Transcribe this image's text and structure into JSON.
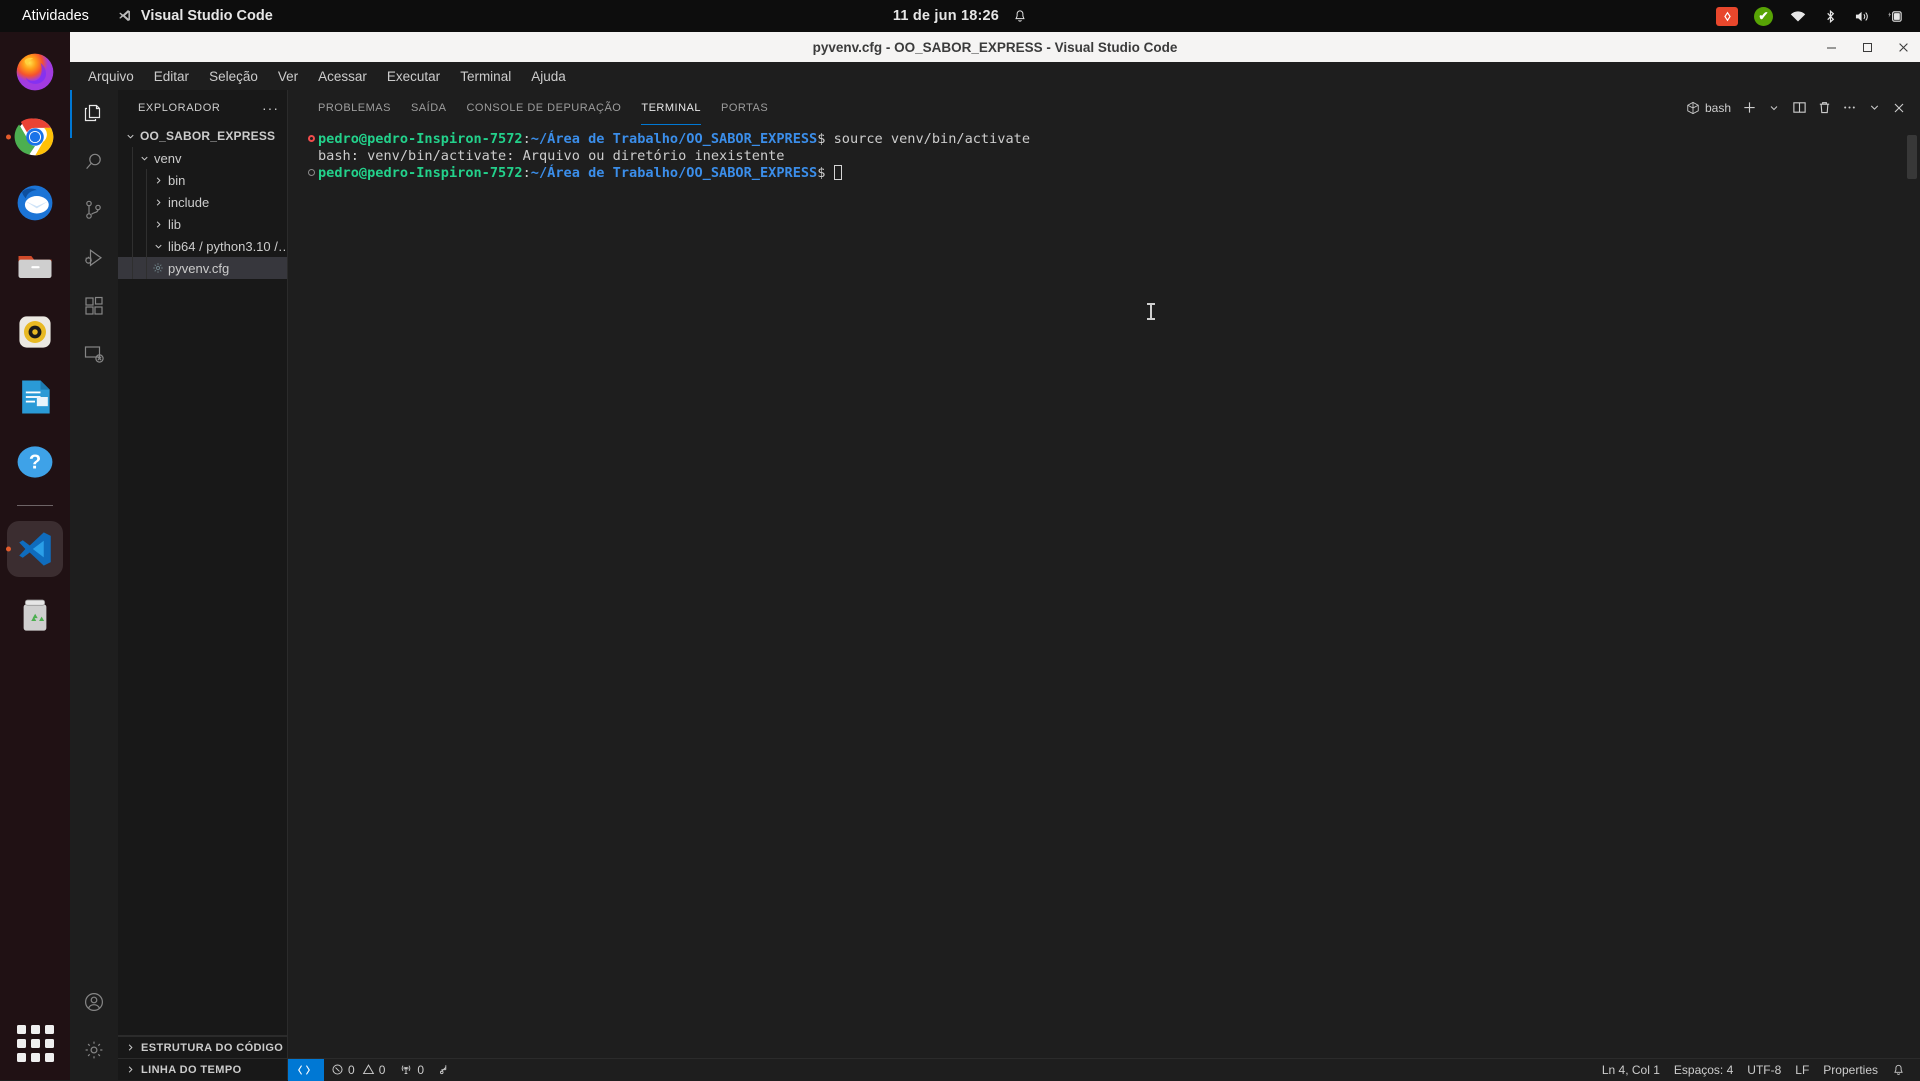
{
  "desktop": {
    "activities_label": "Atividades",
    "app_name": "Visual Studio Code",
    "clock": "11 de jun  18:26",
    "tray": [
      {
        "name": "red-badge-icon",
        "label": ""
      },
      {
        "name": "green-check-icon",
        "label": "✔"
      },
      {
        "name": "wifi-icon",
        "label": ""
      },
      {
        "name": "bluetooth-icon",
        "label": ""
      },
      {
        "name": "volume-icon",
        "label": ""
      },
      {
        "name": "battery-icon",
        "label": ""
      }
    ],
    "dock": [
      {
        "name": "firefox",
        "label": "Firefox"
      },
      {
        "name": "chrome",
        "label": "Google Chrome"
      },
      {
        "name": "thunderbird",
        "label": "Thunderbird Mail"
      },
      {
        "name": "files",
        "label": "Arquivos"
      },
      {
        "name": "rhythmbox",
        "label": "Rhythmbox"
      },
      {
        "name": "libreoffice-writer",
        "label": "LibreOffice Writer"
      },
      {
        "name": "help",
        "label": "Ajuda"
      },
      {
        "name": "vscode",
        "label": "Visual Studio Code"
      },
      {
        "name": "trash",
        "label": "Lixeira"
      }
    ],
    "show_apps_label": "Mostrar aplicativos"
  },
  "window": {
    "title": "pyvenv.cfg - OO_SABOR_EXPRESS - Visual Studio Code",
    "controls": {
      "minimize": "—",
      "maximize": "▫",
      "close": "✕"
    }
  },
  "menubar": [
    "Arquivo",
    "Editar",
    "Seleção",
    "Ver",
    "Acessar",
    "Executar",
    "Terminal",
    "Ajuda"
  ],
  "activitybar": {
    "top": [
      {
        "name": "explorer-icon",
        "active": true
      },
      {
        "name": "search-icon",
        "active": false
      },
      {
        "name": "source-control-icon",
        "active": false
      },
      {
        "name": "run-and-debug-icon",
        "active": false
      },
      {
        "name": "extensions-icon",
        "active": false
      },
      {
        "name": "remote-explorer-icon",
        "active": false
      }
    ],
    "bottom": [
      {
        "name": "accounts-icon"
      },
      {
        "name": "manage-settings-icon"
      }
    ]
  },
  "sidebar": {
    "header": "EXPLORADOR",
    "more_actions": "···",
    "tree": [
      {
        "label": "OO_SABOR_EXPRESS",
        "depth": 0,
        "state": "expanded",
        "type": "folder",
        "selected": false
      },
      {
        "label": "venv",
        "depth": 1,
        "state": "expanded",
        "type": "folder",
        "selected": false
      },
      {
        "label": "bin",
        "depth": 2,
        "state": "collapsed",
        "type": "folder",
        "selected": false
      },
      {
        "label": "include",
        "depth": 2,
        "state": "collapsed",
        "type": "folder",
        "selected": false
      },
      {
        "label": "lib",
        "depth": 2,
        "state": "collapsed",
        "type": "folder",
        "selected": false
      },
      {
        "label": "lib64 / python3.10 /…",
        "depth": 2,
        "state": "expanded",
        "type": "folder",
        "selected": false
      },
      {
        "label": "pyvenv.cfg",
        "depth": 2,
        "state": "file",
        "type": "config-file",
        "selected": true
      }
    ],
    "sections": [
      {
        "label": "ESTRUTURA DO CÓDIGO",
        "state": "collapsed"
      },
      {
        "label": "LINHA DO TEMPO",
        "state": "collapsed"
      }
    ]
  },
  "panel": {
    "tabs": [
      {
        "label": "PROBLEMAS",
        "active": false
      },
      {
        "label": "SAÍDA",
        "active": false
      },
      {
        "label": "CONSOLE DE DEPURAÇÃO",
        "active": false
      },
      {
        "label": "TERMINAL",
        "active": true
      },
      {
        "label": "PORTAS",
        "active": false
      }
    ],
    "shell_label": "bash",
    "actions": [
      {
        "name": "new-terminal-icon",
        "label": "+"
      },
      {
        "name": "chevron-down-icon",
        "label": "⌄"
      },
      {
        "name": "split-terminal-icon",
        "label": ""
      },
      {
        "name": "kill-terminal-icon",
        "label": ""
      },
      {
        "name": "terminal-more-icon",
        "label": "···"
      },
      {
        "name": "maximize-panel-icon",
        "label": "⌄"
      },
      {
        "name": "close-panel-icon",
        "label": "✕"
      }
    ]
  },
  "terminal": {
    "lines": [
      {
        "marker": "error",
        "segments": [
          {
            "text": "pedro@pedro-Inspiron-7572",
            "style": "user"
          },
          {
            "text": ":",
            "style": "plain"
          },
          {
            "text": "~/Área de Trabalho/OO_SABOR_EXPRESS",
            "style": "path"
          },
          {
            "text": "$ source venv/bin/activate",
            "style": "plain"
          }
        ]
      },
      {
        "marker": "none",
        "segments": [
          {
            "text": "bash: venv/bin/activate: Arquivo ou diretório inexistente",
            "style": "plain"
          }
        ]
      },
      {
        "marker": "ok",
        "segments": [
          {
            "text": "pedro@pedro-Inspiron-7572",
            "style": "user"
          },
          {
            "text": ":",
            "style": "plain"
          },
          {
            "text": "~/Área de Trabalho/OO_SABOR_EXPRESS",
            "style": "path"
          },
          {
            "text": "$ ",
            "style": "plain"
          }
        ],
        "cursor": true
      }
    ]
  },
  "statusbar": {
    "remote_label": "",
    "errors": "0",
    "warnings": "0",
    "ports": "0",
    "radio_icon": "radio-tower-icon",
    "forward_icon": "port-forward-icon",
    "right": [
      {
        "name": "cursor-position",
        "label": "Ln 4, Col 1"
      },
      {
        "name": "indentation",
        "label": "Espaços: 4"
      },
      {
        "name": "encoding",
        "label": "UTF-8"
      },
      {
        "name": "line-endings",
        "label": "LF"
      },
      {
        "name": "language-mode",
        "label": "Properties"
      }
    ],
    "bell": "notifications-bell-icon"
  },
  "colors": {
    "accent": "#0078d4",
    "terminal_green": "#23d18b",
    "terminal_blue": "#3b8eea",
    "error_red": "#f14c4c"
  }
}
